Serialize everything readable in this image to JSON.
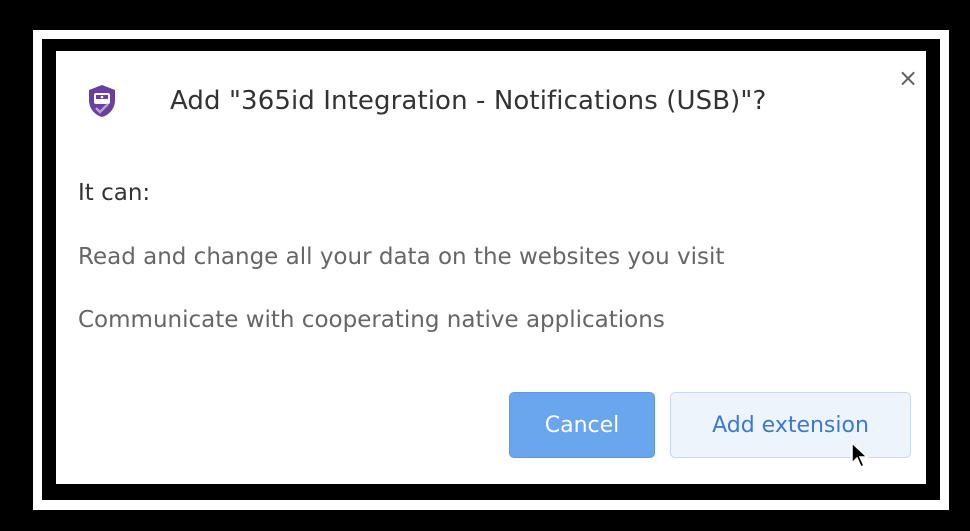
{
  "dialog": {
    "title": "Add \"365id Integration - Notifications (USB)\"?",
    "close_glyph": "×",
    "intro": "It can:",
    "permissions": [
      "Read and change all your data on the websites you visit",
      "Communicate with cooperating native applications"
    ],
    "cancel_label": "Cancel",
    "add_label": "Add extension"
  },
  "icons": {
    "extension_icon": "shield-check-icon",
    "close_icon": "close-icon",
    "cursor": "mouse-pointer-icon"
  },
  "colors": {
    "accent": "#6aa6ee",
    "shield": "#6b3fa0",
    "add_text": "#3b78d8"
  }
}
